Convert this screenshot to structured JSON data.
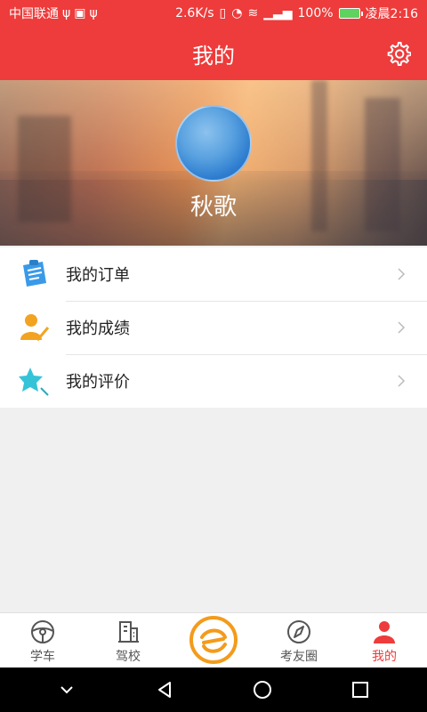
{
  "status": {
    "carrier": "中国联通",
    "speed": "2.6K/s",
    "battery": "100%",
    "time": "凌晨2:16"
  },
  "header": {
    "title": "我的"
  },
  "profile": {
    "name": "秋歌"
  },
  "menu": {
    "items": [
      {
        "label": "我的订单",
        "icon": "clipboard-icon",
        "color": "#3a9ae8"
      },
      {
        "label": "我的成绩",
        "icon": "user-check-icon",
        "color": "#f3a322"
      },
      {
        "label": "我的评价",
        "icon": "star-comment-icon",
        "color": "#35c3d8"
      }
    ]
  },
  "tabs": {
    "items": [
      {
        "label": "学车",
        "icon": "steering-wheel-icon"
      },
      {
        "label": "驾校",
        "icon": "building-icon"
      },
      {
        "label": "",
        "icon": "center-logo-icon"
      },
      {
        "label": "考友圈",
        "icon": "compass-icon"
      },
      {
        "label": "我的",
        "icon": "person-icon",
        "active": true
      }
    ]
  },
  "colors": {
    "brand": "#ee3b3b",
    "center_accent": "#f39b1b"
  }
}
